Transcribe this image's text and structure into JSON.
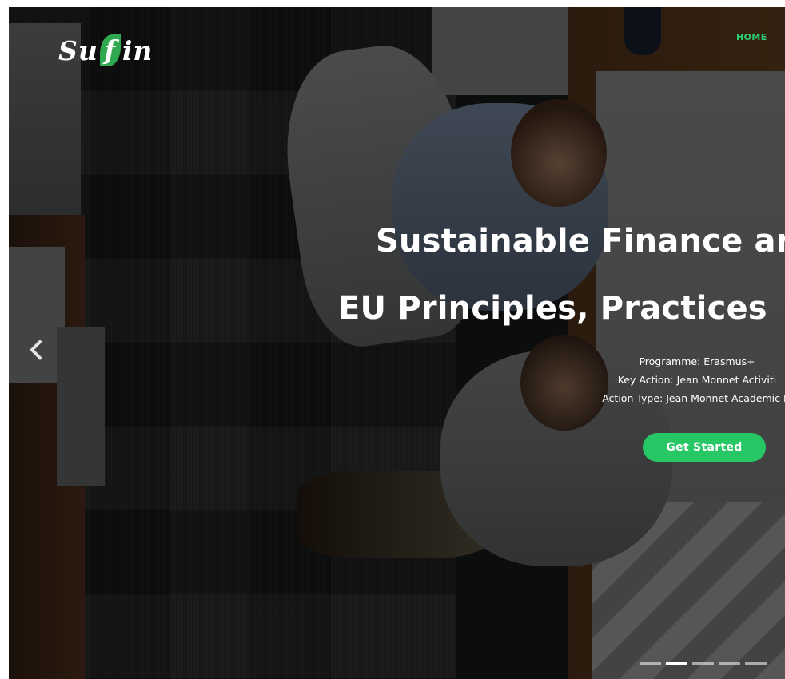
{
  "header": {
    "logo": {
      "prefix": "Su",
      "leaf_letter": "f",
      "suffix": "in"
    },
    "nav": [
      {
        "label": "HOME"
      }
    ],
    "accent_color": "#2bd074"
  },
  "hero": {
    "title": "Sustainable Finance ar",
    "subtitle": "EU Principles, Practices",
    "info_lines": [
      "Programme: Erasmus+",
      "Key Action: Jean Monnet Activiti",
      "Action Type: Jean Monnet Academic M"
    ],
    "cta_label": "Get Started",
    "cta_color": "#28c766"
  },
  "carousel": {
    "prev_icon": "chevron-left-icon",
    "slide_count": 5,
    "active_index": 1
  }
}
